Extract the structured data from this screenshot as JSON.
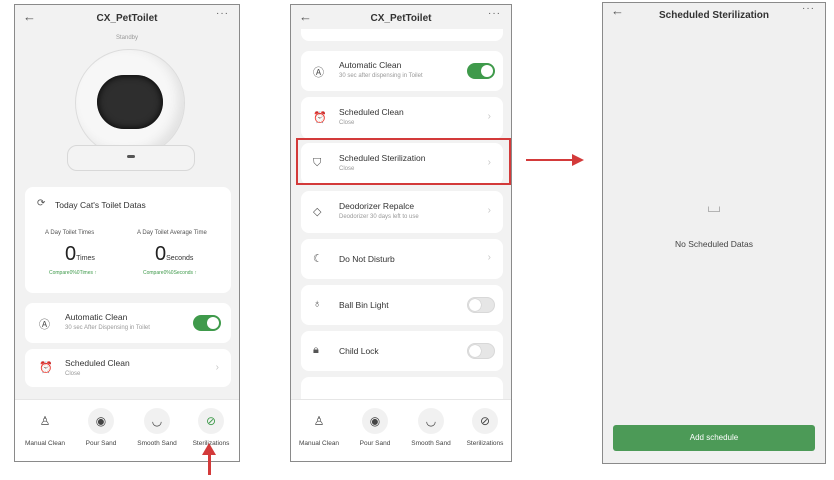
{
  "screen1": {
    "back_icon": "back-arrow-icon",
    "title": "CX_PetToilet",
    "more": "···",
    "status": "Standby",
    "datas_title": "Today Cat's Toilet Datas",
    "times_label": "A Day Toilet Times",
    "avg_label": "A Day Toilet Average Time",
    "times_value": "0",
    "times_unit": "Times",
    "seconds_value": "0",
    "seconds_unit": "Seconds",
    "times_compare": "Compare0%0Times",
    "seconds_compare": "Compare0%0Seconds",
    "auto_clean_title": "Automatic Clean",
    "auto_clean_sub": "30 sec After Dispensing in Toilet",
    "scheduled_clean_title": "Scheduled Clean",
    "scheduled_clean_sub": "Close"
  },
  "screen2": {
    "title": "CX_PetToilet",
    "more": "···",
    "auto_clean_title": "Automatic Clean",
    "auto_clean_sub": "30 sec after dispensing in Toilet",
    "scheduled_clean_title": "Scheduled Clean",
    "scheduled_clean_sub": "Close",
    "sterilization_title": "Scheduled Sterilization",
    "sterilization_sub": "Close",
    "deodorizer_title": "Deodorizer Repalce",
    "deodorizer_sub": "Deodorizer 30 days left to use",
    "dnd_title": "Do Not Disturb",
    "ball_light_title": "Ball Bin Light",
    "child_lock_title": "Child Lock"
  },
  "screen3": {
    "title": "Scheduled Sterilization",
    "more": "···",
    "empty_text": "No Scheduled Datas",
    "add_button": "Add schedule"
  },
  "nav": {
    "manual_clean": "Manual Clean",
    "pour_sand": "Pour Sand",
    "smooth_sand": "Smooth Sand",
    "sterilizations": "Sterilizations"
  },
  "colors": {
    "accent_green": "#3f9a4b",
    "highlight_red": "#d33a3a"
  }
}
